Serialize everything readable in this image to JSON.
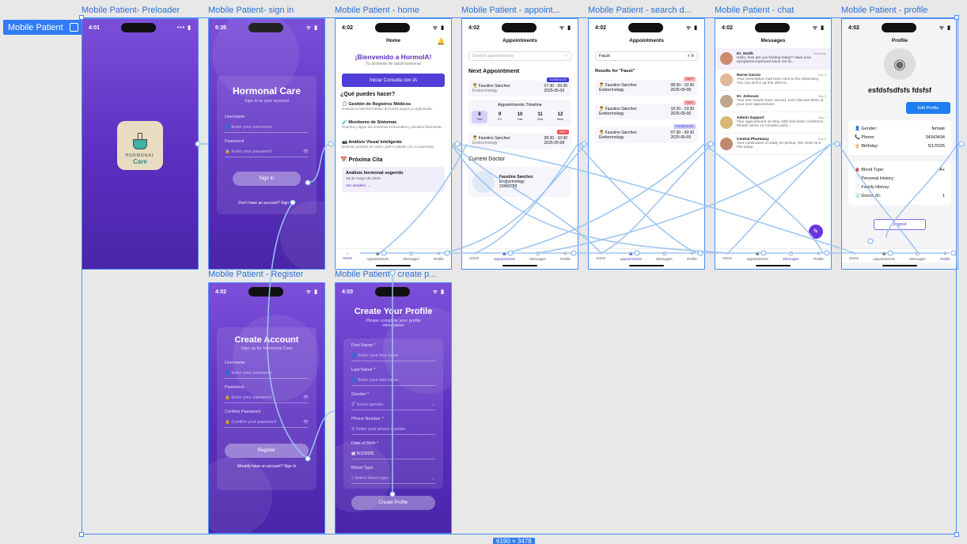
{
  "section": {
    "name": "Mobile Patient"
  },
  "frames": [
    {
      "label": "Mobile Patient- Preloader"
    },
    {
      "label": "Mobile Patient- sign in"
    },
    {
      "label": "Mobile Patient - home"
    },
    {
      "label": "Mobile Patient - appoint..."
    },
    {
      "label": "Mobile Patient - search d..."
    },
    {
      "label": "Mobile Patient - chat"
    },
    {
      "label": "Mobile Patient - profile"
    },
    {
      "label": "Mobile Patient - Register"
    },
    {
      "label": "Mobile Patient - create p..."
    }
  ],
  "canvas_size": "6190 × 3478",
  "preloader": {
    "time": "4:01",
    "logo_line1": "HORMONAL",
    "logo_line2": "Care"
  },
  "signin": {
    "time": "6:35",
    "title": "Hormonal Care",
    "subtitle": "Sign in to your account",
    "username_label": "Username",
    "username_ph": "Enter your username",
    "password_label": "Password",
    "password_ph": "Enter your password",
    "button": "Sign In",
    "footer": "Don't have an account? Sign Up"
  },
  "home": {
    "time": "4:02",
    "header": "Home",
    "welcome": "¡Bienvenido a HormoIA!",
    "welcome_sub": "Tu asistente de salud hormonal",
    "cta": "Iniciar Consulta con IA",
    "section_q": "¿Qué puedes hacer?",
    "features": [
      {
        "title": "Gestión de Registros Médicos",
        "desc": "Guarda tu historial médico de forma segura y organizada."
      },
      {
        "title": "Monitoreo de Síntomas",
        "desc": "Reporta y sigue tus síntomas hormonales y visuales fácilmente."
      },
      {
        "title": "Análisis Visual Inteligente",
        "desc": "Detecta cambios en rostro, piel o cabello con IA avanzada."
      }
    ],
    "next_title": "Próxima Cita",
    "next_item": "Análisis hormonal sugerido",
    "next_date": "15 de mayo de 2025",
    "next_link": "Ver detalles →",
    "nav": [
      "Home",
      "Appointments",
      "Messages",
      "Profile"
    ]
  },
  "appointments": {
    "time": "4:02",
    "header": "Appointments",
    "search_ph": "Search appointments",
    "next_title": "Next Appointment",
    "badge_scheduled": "SCHEDULED",
    "badge_past": "PAST",
    "doctor": "Faustino Sanchez",
    "spec": "Endocrinology",
    "time1": "07:30 - 09:30",
    "date1": "2025-05-09",
    "timeline_title": "Appointments Timeline",
    "days": [
      {
        "n": "8",
        "d": "Thu"
      },
      {
        "n": "9",
        "d": "Fri"
      },
      {
        "n": "10",
        "d": "Sat"
      },
      {
        "n": "11",
        "d": "Sun"
      },
      {
        "n": "12",
        "d": "Mon"
      }
    ],
    "time2": "08:30 - 10:30",
    "date2": "2025-05-08",
    "current_title": "Current Doctor",
    "doc_phone": "23456789"
  },
  "search": {
    "time": "4:02",
    "header": "Appointments",
    "query": "Faust",
    "results": "Results for \"Faust\"",
    "items": [
      {
        "badge": "PAST",
        "doctor": "Faustino Sanchez",
        "spec": "Endocrinology",
        "time": "08:30 - 10:30",
        "date": "2025-05-08"
      },
      {
        "badge": "PAST",
        "doctor": "Faustino Sanchez",
        "spec": "Endocrinology",
        "time": "18:30 - 19:30",
        "date": "2025-05-06"
      },
      {
        "badge": "SCHEDULED",
        "doctor": "Faustino Sanchez",
        "spec": "Endocrinology",
        "time": "07:30 - 09:30",
        "date": "2025-05-09"
      }
    ]
  },
  "chat": {
    "time": "4:02",
    "header": "Messages",
    "items": [
      {
        "name": "Dr. Smith",
        "when": "Yesterday",
        "text": "Hello, how are you feeling today? Have your symptoms improved since our la..."
      },
      {
        "name": "Nurse Garcia",
        "when": "May 9",
        "text": "Your prescription has been sent to the pharmacy. You can pick it up this afterno..."
      },
      {
        "name": "Dr. Johnson",
        "when": "May 8",
        "text": "Your test results have arrived. Let's discuss them at your next appointment."
      },
      {
        "name": "Admin Support",
        "when": "May 7",
        "text": "Your appointment on May 15th has been confirmed. Please arrive 15 minutes early..."
      },
      {
        "name": "Central Pharmacy",
        "when": "May 6",
        "text": "Your medication is ready for pickup. We close at 8 PM today."
      }
    ]
  },
  "profile": {
    "time": "4:02",
    "header": "Profile",
    "name": "esfdsfsdfsfs fdsfsf",
    "edit": "Edit Profile",
    "gender_l": "Gender:",
    "gender_v": "female",
    "phone_l": "Phone:",
    "phone_v": "34343434",
    "birth_l": "Birthday:",
    "birth_v": "5/1/2025",
    "blood_l": "Blood Type:",
    "blood_v": "A+",
    "personal_l": "Personal History:",
    "family_l": "Family History:",
    "doctor_l": "Doctor ID:",
    "doctor_v": "1",
    "logout": "Logout"
  },
  "register": {
    "time": "4:02",
    "title": "Create Account",
    "subtitle": "Sign up for Hormonal Care",
    "username_label": "Username",
    "username_ph": "Enter your username",
    "password_label": "Password",
    "password_ph": "Enter your password",
    "confirm_label": "Confirm Password",
    "confirm_ph": "Confirm your password",
    "button": "Register",
    "footer": "Already have an account? Sign In"
  },
  "createprofile": {
    "time": "4:03",
    "title": "Create Your Profile",
    "subtitle": "Please complete your profile information",
    "first_l": "First Name *",
    "first_ph": "Enter your first name",
    "last_l": "Last Name *",
    "last_ph": "Enter your last name",
    "gender_l": "Gender *",
    "gender_ph": "Select gender",
    "phone_l": "Phone Number *",
    "phone_ph": "Enter your phone number",
    "dob_l": "Date of Birth *",
    "dob_v": "5/1/2025",
    "blood_l": "Blood Type",
    "blood_ph": "Select blood type",
    "button": "Create Profile"
  },
  "colors": {
    "accent": "#5b2fc0",
    "selection": "#4a8df7",
    "past": "#e55",
    "scheduled": "#3b35d9"
  }
}
